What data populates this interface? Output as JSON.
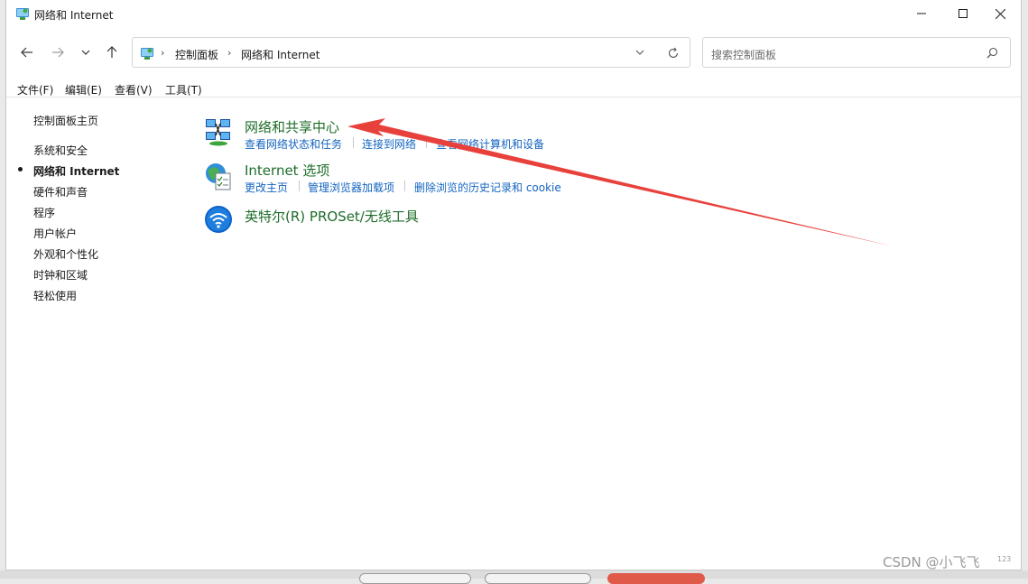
{
  "window": {
    "title": "网络和 Internet",
    "controls": {
      "minimize": "minimize-icon",
      "maximize": "maximize-icon",
      "close": "close-icon"
    }
  },
  "nav": {
    "back": "back-arrow-icon",
    "forward": "forward-arrow-icon",
    "recent": "chevron-down-icon",
    "up": "up-arrow-icon",
    "breadcrumb": [
      "控制面板",
      "网络和 Internet"
    ],
    "refresh": "refresh-icon",
    "search_placeholder": "搜索控制面板"
  },
  "menu": [
    "文件(F)",
    "编辑(E)",
    "查看(V)",
    "工具(T)"
  ],
  "sidebar": {
    "home": "控制面板主页",
    "items": [
      "系统和安全",
      "网络和 Internet",
      "硬件和声音",
      "程序",
      "用户帐户",
      "外观和个性化",
      "时钟和区域",
      "轻松使用"
    ],
    "current_index": 1
  },
  "categories": [
    {
      "title": "网络和共享中心",
      "icon": "network-sharing-center-icon",
      "links": [
        "查看网络状态和任务",
        "连接到网络",
        "查看网络计算机和设备"
      ]
    },
    {
      "title": "Internet 选项",
      "icon": "internet-options-icon",
      "links": [
        "更改主页",
        "管理浏览器加载项",
        "删除浏览的历史记录和 cookie"
      ]
    },
    {
      "title": "英特尔(R) PROSet/无线工具",
      "icon": "intel-wireless-icon",
      "links": []
    }
  ],
  "annotation": {
    "color": "#e8413c"
  },
  "watermark": {
    "text": "CSDN @小飞飞",
    "suffix": "123"
  },
  "colors": {
    "category_title": "#1e6d2a",
    "link": "#1565c0"
  }
}
